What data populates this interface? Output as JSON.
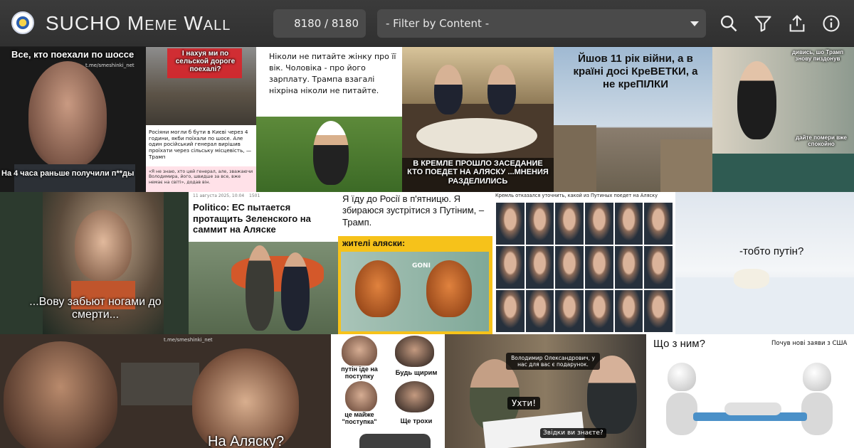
{
  "header": {
    "title": "SUCHO Meme Wall",
    "counter": "8180 / 8180",
    "filter_placeholder": "- Filter by Content -"
  },
  "icons": [
    "search-icon",
    "filter-icon",
    "share-icon",
    "info-icon"
  ],
  "colors": {
    "topbar": "#333333",
    "control": "#4a4a4a"
  },
  "tiles": {
    "t1": {
      "caption_top": "Все, кто поехали по шоссе",
      "caption_bottom": "На 4 часа раньше получили п**ды",
      "watermark": "t.me/smeshinki_net"
    },
    "t2": {
      "caption_top": "І нахуя ми по сельской дороге поехалі?",
      "text": "Росіяни могли б бути в Києві через 4 години, якби поїхали по шосе. Але один російський генерал вирішив проїхати через сільську місцевість, — Трамп",
      "text2": "«Я не знаю, хто цей генерал, але, зважаючи Володимира, його, швидше за все, вже немає на світі», додав він."
    },
    "t3": {
      "caption": "Ніколи не питайте жінку про її вік. Чоловіка - про його зарплату. Трампа взагалі ніхріна ніколи не питайте."
    },
    "t4": {
      "caption": "В КРЕМЛЕ ПРОШЛО ЗАСЕДАНИЕ КТО ПОЕДЕТ НА АЛЯСКУ ...МНЕНИЯ РАЗДЕЛИЛИСЬ"
    },
    "t5": {
      "caption": "Йшов 11 рік війни, а в країні досі КреВЕТКИ, а не креПІЛКИ"
    },
    "t6": {
      "caption_top": "дивись, шо Трамп знову пиздонув",
      "caption_bottom": "дайте помери вже спокойно"
    },
    "t7": {
      "caption": "...Вову забьют ногами до смерти..."
    },
    "t8": {
      "date": "11 августа 2025, 10:04",
      "views": "1501",
      "headline": "Politico: ЕС пытается протащить Зеленского на саммит на Аляске"
    },
    "t9": {
      "caption": "Я їду до Росії в п'ятницю. Я збираюся зустрітися з Путіним, – Трамп.",
      "label": "жителі аляски:",
      "logo": "GONI"
    },
    "t10": {
      "caption": "Кремль отказался уточнить, какой из Путиных поедет на Аляску"
    },
    "t11": {
      "caption": "-тобто путін?"
    },
    "t12": {
      "caption": "На Аляску?",
      "watermark": "t.me/smeshinki_net"
    },
    "t13": {
      "p1": "путін іде на поступку",
      "p2": "Будь щирим",
      "p3": "це майже \"поступка\"",
      "p4": "Ще трохи"
    },
    "t14": {
      "bubble1": "Володимир Олександрович, у нас для вас є подарунок.",
      "bubble2": "Ухти!",
      "bubble3": "Звідки ви знаєте?"
    },
    "t15": {
      "caption_left": "Що з ним?",
      "caption_right": "Почув нові заяви з США"
    }
  }
}
